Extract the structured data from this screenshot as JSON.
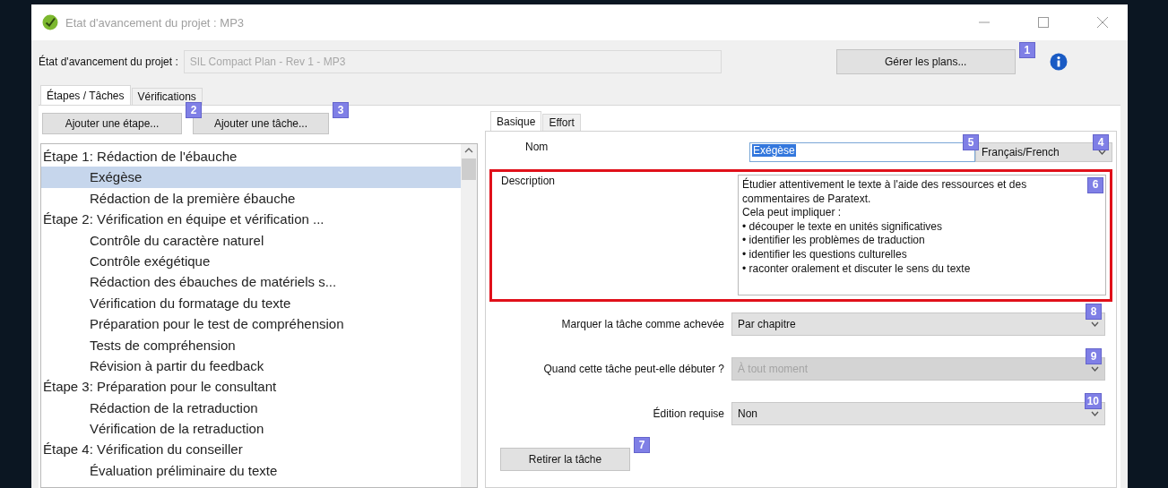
{
  "window": {
    "title": "Etat d'avancement du projet : MP3"
  },
  "project": {
    "label": "État d'avancement du projet :",
    "value": "SIL Compact Plan - Rev 1 - MP3"
  },
  "manage_button": {
    "label": "Gérer les plans...",
    "badge": "1"
  },
  "tabs": [
    {
      "label": "Étapes / Tâches",
      "selected": true
    },
    {
      "label": "Vérifications",
      "selected": false
    }
  ],
  "toolbar": [
    {
      "label": "Ajouter une étape...",
      "badge": "2"
    },
    {
      "label": "Ajouter une tâche...",
      "badge": "3"
    }
  ],
  "tree": [
    {
      "label": "Étape 1: Rédaction de l'ébauche",
      "selected": false,
      "children": [
        {
          "label": "Exégèse",
          "selected": true
        },
        {
          "label": "Rédaction de la première ébauche",
          "selected": false
        }
      ]
    },
    {
      "label": "Étape 2: Vérification en équipe et vérification ...",
      "selected": false,
      "children": [
        {
          "label": "Contrôle du caractère naturel",
          "selected": false
        },
        {
          "label": "Contrôle exégétique",
          "selected": false
        },
        {
          "label": "Rédaction des ébauches de matériels s...",
          "selected": false
        },
        {
          "label": "Vérification du formatage du texte",
          "selected": false
        },
        {
          "label": "Préparation pour le test de compréhension",
          "selected": false
        },
        {
          "label": "Tests de compréhension",
          "selected": false
        },
        {
          "label": "Révision à partir du feedback",
          "selected": false
        }
      ]
    },
    {
      "label": "Étape 3: Préparation pour le consultant",
      "selected": false,
      "children": [
        {
          "label": "Rédaction de la retraduction",
          "selected": false
        },
        {
          "label": "Vérification de la retraduction",
          "selected": false
        }
      ]
    },
    {
      "label": "Étape 4: Vérification du conseiller",
      "selected": false,
      "children": [
        {
          "label": "Évaluation préliminaire du texte",
          "selected": false
        }
      ]
    }
  ],
  "detail_tabs": [
    {
      "label": "Basique",
      "selected": true
    },
    {
      "label": "Effort",
      "selected": false
    }
  ],
  "name_field": {
    "label": "Nom",
    "value": "Exégèse",
    "badge": "5"
  },
  "language": {
    "value": "Français/French",
    "badge": "4"
  },
  "description": {
    "label": "Description",
    "highlighted": true,
    "badge": "6",
    "lines": [
      "Étudier attentivement le texte à l'aide des ressources et des commentaires de Paratext.",
      "Cela peut impliquer :",
      "• découper le texte en unités significatives",
      "• identifier les problèmes de traduction",
      "• identifier les questions culturelles",
      "• raconter oralement et discuter le sens du texte"
    ]
  },
  "settings": [
    {
      "label": "Marquer la tâche comme achevée",
      "value": "Par chapitre",
      "disabled": false,
      "badge": "8"
    },
    {
      "label": "Quand cette tâche peut-elle débuter ?",
      "value": "À tout moment",
      "disabled": true,
      "badge": "9"
    },
    {
      "label": "Édition requise",
      "value": "Non",
      "disabled": false,
      "badge": "10"
    }
  ],
  "remove_button": {
    "label": "Retirer la tâche",
    "badge": "7"
  }
}
